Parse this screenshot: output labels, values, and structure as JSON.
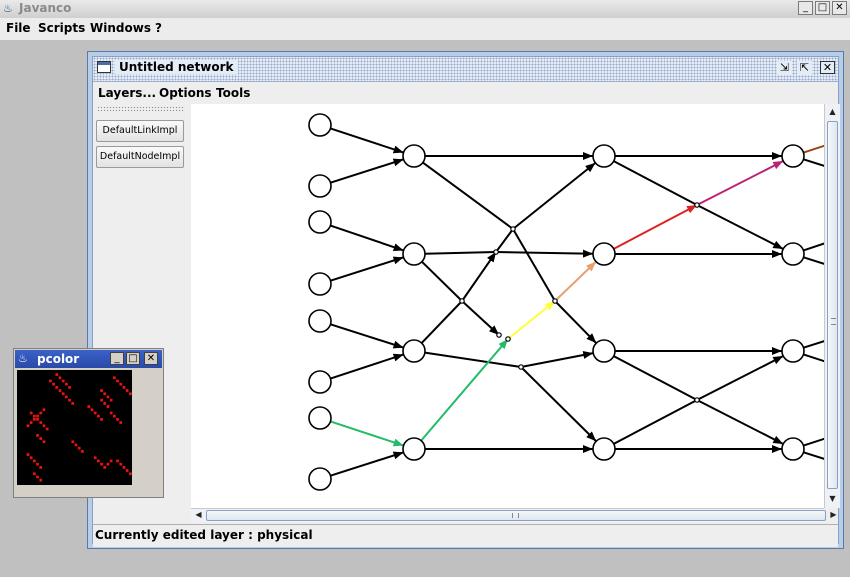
{
  "app": {
    "title": "Javanco",
    "icon": "java-coffee-icon",
    "controls": {
      "minimize": "_",
      "maximize": "□",
      "close": "✕"
    }
  },
  "menubar": {
    "items": [
      "File",
      "Scripts",
      "Windows",
      "?"
    ]
  },
  "network_window": {
    "title": "Untitled network",
    "controls": {
      "minimize": "⇲",
      "maximize": "⇱",
      "close": "✕"
    },
    "menu": [
      "Layers...",
      "Options",
      "Tools"
    ],
    "layer_buttons": [
      "DefaultLinkImpl",
      "DefaultNodeImpl"
    ],
    "status": "Currently edited layer : physical",
    "scroll_arrows": {
      "up": "▲",
      "down": "▼",
      "left": "◀",
      "right": "▶"
    },
    "colors": {
      "edge": "#000000",
      "node_fill": "#ffffff",
      "path": [
        "#22bb66",
        "#aadd33",
        "#ffff33",
        "#e8a070",
        "#dd2222",
        "#bb2277",
        "#a04010"
      ]
    }
  },
  "pcolor_window": {
    "title": "pcolor",
    "icon": "java-coffee-icon",
    "controls": {
      "minimize": "_",
      "maximize": "□",
      "close": "✕"
    },
    "colors": {
      "background": "#000000",
      "cell": "#ee1111"
    }
  }
}
